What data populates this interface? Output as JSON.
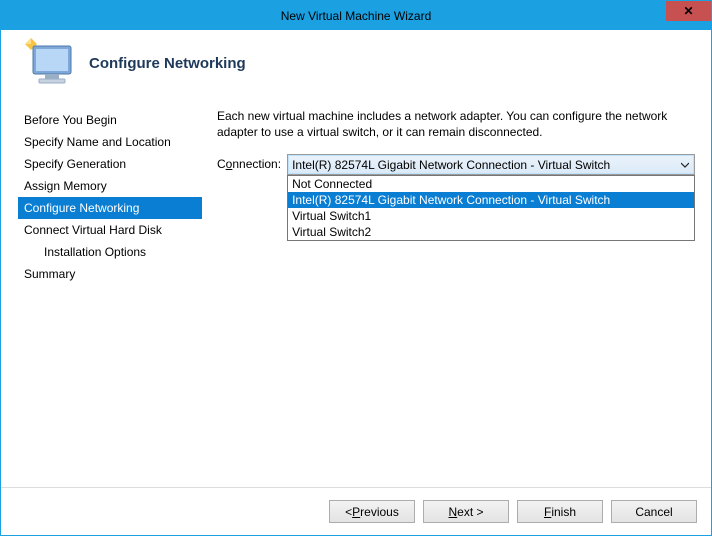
{
  "window": {
    "title": "New Virtual Machine Wizard"
  },
  "header": {
    "title": "Configure Networking"
  },
  "sidebar": {
    "items": [
      {
        "label": "Before You Begin",
        "active": false,
        "indent": false
      },
      {
        "label": "Specify Name and Location",
        "active": false,
        "indent": false
      },
      {
        "label": "Specify Generation",
        "active": false,
        "indent": false
      },
      {
        "label": "Assign Memory",
        "active": false,
        "indent": false
      },
      {
        "label": "Configure Networking",
        "active": true,
        "indent": false
      },
      {
        "label": "Connect Virtual Hard Disk",
        "active": false,
        "indent": false
      },
      {
        "label": "Installation Options",
        "active": false,
        "indent": true
      },
      {
        "label": "Summary",
        "active": false,
        "indent": false
      }
    ]
  },
  "content": {
    "description": "Each new virtual machine includes a network adapter. You can configure the network adapter to use a virtual switch, or it can remain disconnected.",
    "connection_label_pre": "C",
    "connection_label_ul": "o",
    "connection_label_post": "nnection:",
    "selected": "Intel(R) 82574L Gigabit Network Connection - Virtual Switch",
    "options": [
      {
        "label": "Not Connected",
        "highlighted": false
      },
      {
        "label": "Intel(R) 82574L Gigabit Network Connection - Virtual Switch",
        "highlighted": true
      },
      {
        "label": "Virtual Switch1",
        "highlighted": false
      },
      {
        "label": "Virtual Switch2",
        "highlighted": false
      }
    ]
  },
  "buttons": {
    "previous_pre": "< ",
    "previous_ul": "P",
    "previous_post": "revious",
    "next_ul": "N",
    "next_post": "ext >",
    "finish_ul": "F",
    "finish_post": "inish",
    "cancel": "Cancel"
  }
}
